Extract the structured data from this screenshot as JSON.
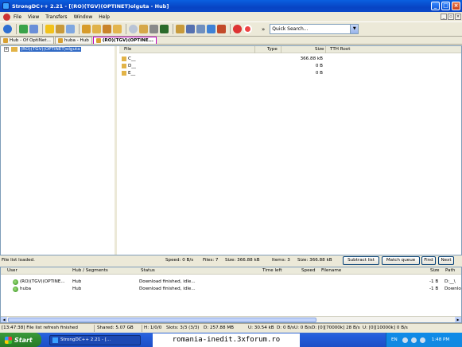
{
  "window": {
    "title": "StrongDC++ 2.21 - [(RO)(TGV)(OPTINET)olguta - Hub]"
  },
  "menu": [
    "File",
    "View",
    "Transfers",
    "Window",
    "Help"
  ],
  "toolbar": {
    "quick_search_placeholder": "Quick Search...",
    "more": "»"
  },
  "tabs": [
    {
      "label": "Hub - Of OptiNet...",
      "active": false
    },
    {
      "label": "huba - Hub",
      "active": false
    },
    {
      "label": "(RO)(TGV)(OPTINE...",
      "active": true
    }
  ],
  "tree": {
    "root": "(RO)(TGV)(OPTINET)olguta"
  },
  "file_list": {
    "columns": {
      "file": "File",
      "type": "Type",
      "size": "Size",
      "tth": "TTH Root"
    },
    "rows": [
      {
        "name": "C__",
        "size": "366.88 kB"
      },
      {
        "name": "D__",
        "size": "0 B"
      },
      {
        "name": "E__",
        "size": "0 B"
      }
    ]
  },
  "file_status": {
    "message": "File list loaded.",
    "speed": "Speed: 0 B/s",
    "files": "Files: 7",
    "size": "Size: 366.88 kB",
    "items": "Items: 3",
    "size2": "Size: 366.88 kB",
    "subtract": "Subtract list",
    "match": "Match queue",
    "find": "Find",
    "next": "Next"
  },
  "transfers": {
    "columns": {
      "user": "User",
      "hub": "Hub / Segments",
      "status": "Status",
      "time": "Time left",
      "speed": "Speed",
      "filename": "Filename",
      "size": "Size",
      "path": "Path"
    },
    "rows": [
      {
        "user": "(RO)(TGV)(OPTINE...",
        "hub": "Hub",
        "status": "Download finished, idle...",
        "size": "-1 B",
        "path": "D:__\\"
      },
      {
        "user": "huba",
        "hub": "Hub",
        "status": "Download finished, idle...",
        "size": "-1 B",
        "path": "Downlo"
      }
    ]
  },
  "statusbar": {
    "message": "[13:47:38] File list refresh finished",
    "shared": "Shared: 5.07 GB",
    "hubs": "H: 1/0/0",
    "slots": "Slots: 3/3 (3/3)",
    "downloaded": "D: 257.88 MB",
    "uploaded": "U: 30.54 kB",
    "d_rate": "D: 0 B/s",
    "u_rate": "U: 0 B/s",
    "d_limit": "D: [0][70000k] 28 B/s",
    "u_limit": "U: [0][10000k] 0 B/s"
  },
  "taskbar": {
    "start": "Start",
    "task": "StrongDC++ 2.21 - [...",
    "banner": "romania-inedit.3xforum.ro",
    "lang": "EN",
    "clock": "1:48 PM"
  }
}
